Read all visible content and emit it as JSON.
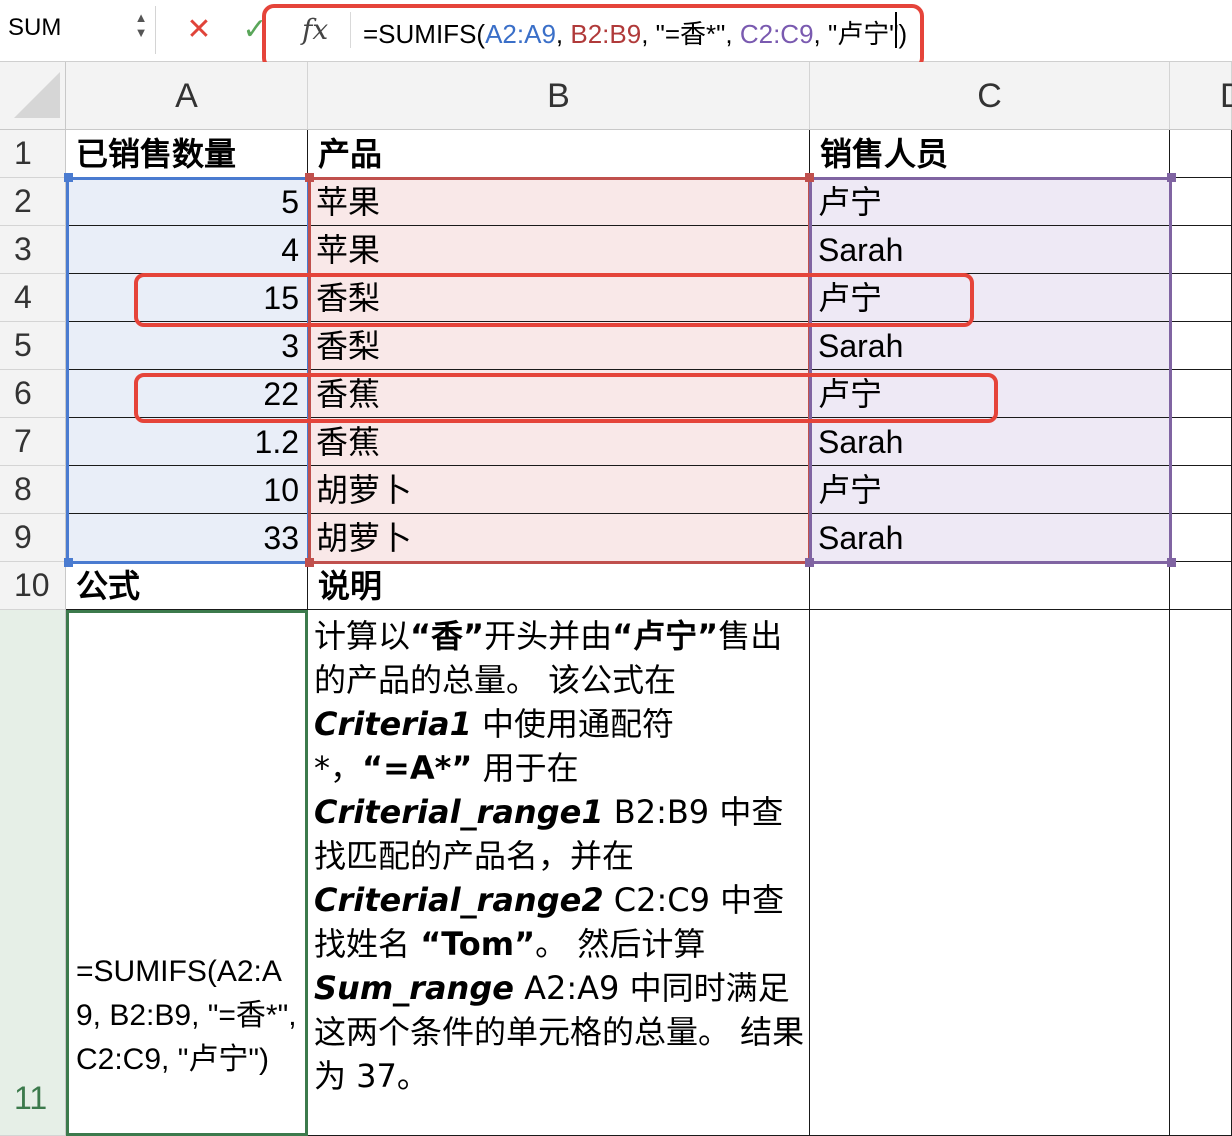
{
  "formula_bar": {
    "name_box": "SUM",
    "cancel_icon": "✕",
    "confirm_icon": "✓",
    "fx_label": "fx",
    "formula_parts": [
      {
        "text": "=SUMIFS(",
        "color": "#000000"
      },
      {
        "text": "A2:A9",
        "color": "#3a6fc8"
      },
      {
        "text": ", ",
        "color": "#000000"
      },
      {
        "text": "B2:B9",
        "color": "#b03a3a"
      },
      {
        "text": ", \"=香*\", ",
        "color": "#000000"
      },
      {
        "text": "C2:C9",
        "color": "#7a5ab0"
      },
      {
        "text": ", \"卢宁\")",
        "color": "#000000"
      }
    ]
  },
  "columns": [
    "A",
    "B",
    "C",
    "D"
  ],
  "rows": [
    "1",
    "2",
    "3",
    "4",
    "5",
    "6",
    "7",
    "8",
    "9",
    "10",
    "11"
  ],
  "header_row": {
    "a": "已销售数量",
    "b": "产品",
    "c": "销售人员"
  },
  "data_rows": [
    {
      "a": "5",
      "b": "苹果",
      "c": "卢宁"
    },
    {
      "a": "4",
      "b": "苹果",
      "c": "Sarah"
    },
    {
      "a": "15",
      "b": "香梨",
      "c": "卢宁"
    },
    {
      "a": "3",
      "b": "香梨",
      "c": "Sarah"
    },
    {
      "a": "22",
      "b": "香蕉",
      "c": "卢宁"
    },
    {
      "a": "1.2",
      "b": "香蕉",
      "c": "Sarah"
    },
    {
      "a": "10",
      "b": "胡萝卜",
      "c": "卢宁"
    },
    {
      "a": "33",
      "b": "胡萝卜",
      "c": "Sarah"
    }
  ],
  "row10": {
    "a": "公式",
    "b": "说明"
  },
  "row11": {
    "a": "=SUMIFS(A2:A9, B2:B9, \"=香*\", C2:C9, \"卢宁\")",
    "b_segments": [
      {
        "t": "计算以",
        "s": "n"
      },
      {
        "t": "“香”",
        "s": "b"
      },
      {
        "t": "开头并由",
        "s": "n"
      },
      {
        "t": "“卢宁”",
        "s": "b"
      },
      {
        "t": "售出的产品的总量。 该公式在 ",
        "s": "n"
      },
      {
        "t": "Criteria1",
        "s": "i"
      },
      {
        "t": " 中使用通配符 *，",
        "s": "n"
      },
      {
        "t": "“=A*”",
        "s": "b"
      },
      {
        "t": " 用于在 ",
        "s": "n"
      },
      {
        "t": "Criterial_range1",
        "s": "i"
      },
      {
        "t": " B2:B9 中查找匹配的产品名，并在 ",
        "s": "n"
      },
      {
        "t": "Criterial_range2",
        "s": "i"
      },
      {
        "t": " C2:C9 中查找姓名 ",
        "s": "n"
      },
      {
        "t": "“Tom”",
        "s": "b"
      },
      {
        "t": "。 然后计算 ",
        "s": "n"
      },
      {
        "t": "Sum_range",
        "s": "i"
      },
      {
        "t": " A2:A9 中同时满足这两个条件的单元格的总量。 结果为 37。",
        "s": "n"
      }
    ]
  },
  "colors": {
    "highlight": "#e5443a",
    "range_a": "#4a7bd0",
    "range_b": "#c0504d",
    "range_c": "#8064a2",
    "selection": "#3c7a4c"
  }
}
